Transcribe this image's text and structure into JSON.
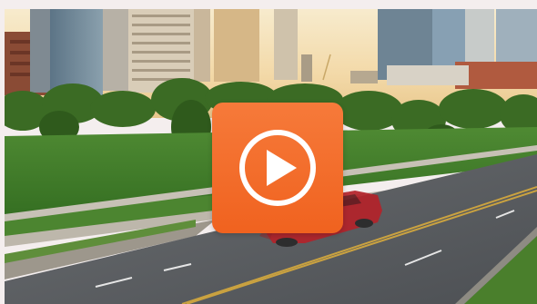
{
  "video": {
    "scene": "city-park-road-skyline-thumbnail",
    "overlay_button": {
      "icon": "play-icon",
      "color": "#f26a27",
      "glyph_color": "#ffffff"
    }
  },
  "colors": {
    "background": "#f4eeee",
    "sky": "#f3dcb4",
    "grass": "#3f7a2a",
    "road": "#5d6166",
    "car": "#b3232a",
    "lane_line": "#caa240"
  }
}
